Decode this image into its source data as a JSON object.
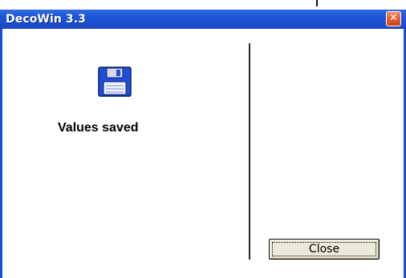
{
  "window": {
    "title": "DecoWin 3.3",
    "close_glyph": "✕",
    "accent_color": "#1b4fd2",
    "close_color": "#e35b2c"
  },
  "message": {
    "icon": "floppy-disk-icon",
    "text": "Values saved"
  },
  "actions": {
    "close_label": "Close"
  }
}
